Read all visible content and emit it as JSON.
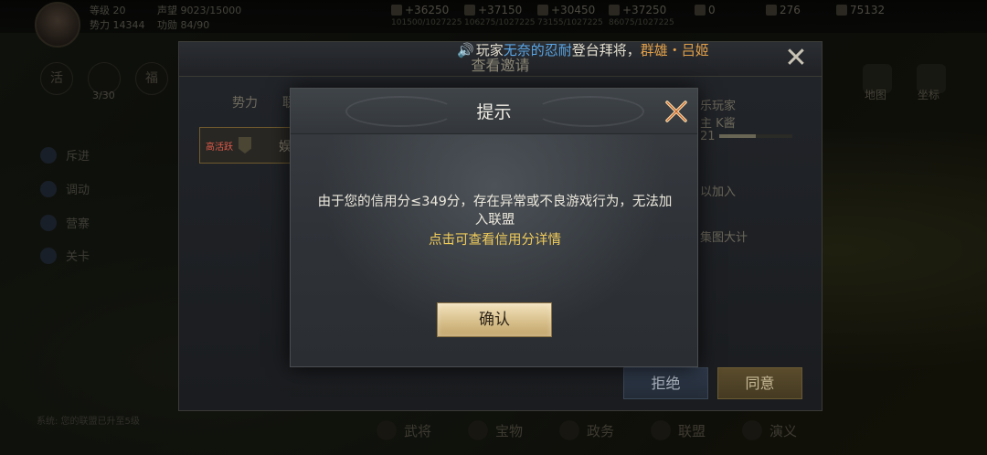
{
  "hud": {
    "level": "等级 20",
    "power": "势力 14344",
    "fame": "声望 9023/15000",
    "merit": "功勋 84/90",
    "resources": [
      {
        "icon": "wood-icon",
        "value": "+36250",
        "sub": "101500/1027225"
      },
      {
        "icon": "iron-icon",
        "value": "+37150",
        "sub": "106275/1027225"
      },
      {
        "icon": "stone-icon",
        "value": "+30450",
        "sub": "73155/1027225"
      },
      {
        "icon": "grain-icon",
        "value": "+37250",
        "sub": "86075/1027225"
      }
    ],
    "jade": "0",
    "copper": "276",
    "gold": "75132",
    "counter": "3/30"
  },
  "side_menu": [
    {
      "label": "斥进"
    },
    {
      "label": "调动"
    },
    {
      "label": "营寨"
    },
    {
      "label": "关卡"
    }
  ],
  "side_icons": [
    "活",
    "福"
  ],
  "right_icons": [
    {
      "label": "地图"
    },
    {
      "label": "坐标"
    }
  ],
  "bottom_bar": [
    {
      "label": "武将"
    },
    {
      "label": "宝物"
    },
    {
      "label": "政务"
    },
    {
      "label": "联盟"
    },
    {
      "label": "演义"
    }
  ],
  "chat_lines": [
    "系统: 您的联盟已升至5级"
  ],
  "broadcast": {
    "prefix": "玩家",
    "player": "无奈的忍耐",
    "middle": "登台拜将，",
    "hero": "群雄・吕姬"
  },
  "invite_panel": {
    "title": "查看邀请",
    "tab_power": "势力",
    "tab_other": "联",
    "active_badge": "高活跃",
    "row_name": "娱",
    "right_top": "乐玩家",
    "right_second": "主 K酱",
    "right_level": "21",
    "exp_fraction": 0.5,
    "join_text": "以加入",
    "map_text": "集图大计",
    "reject_label": "拒绝",
    "agree_label": "同意"
  },
  "prompt": {
    "title": "提示",
    "message": "由于您的信用分≤349分，存在异常或不良游戏行为，无法加入联盟",
    "link": "点击可查看信用分详情",
    "confirm_label": "确认"
  }
}
